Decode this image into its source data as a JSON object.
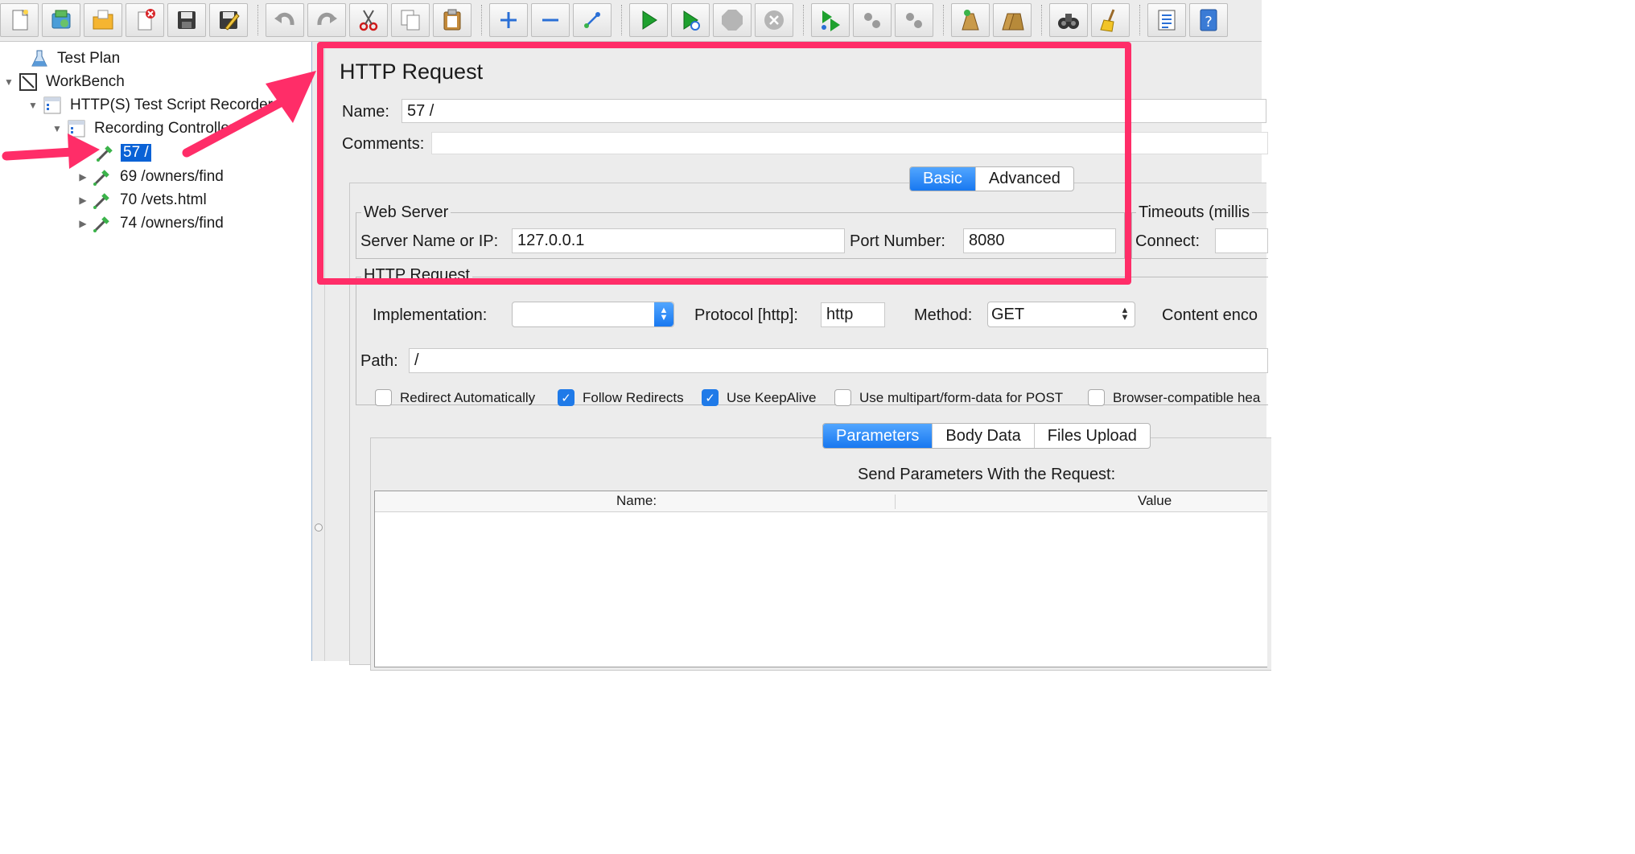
{
  "toolbar": {
    "buttons": [
      {
        "name": "new-icon"
      },
      {
        "name": "templates-icon"
      },
      {
        "name": "open-icon"
      },
      {
        "name": "close-icon"
      },
      {
        "name": "save-icon"
      },
      {
        "name": "save-as-icon"
      },
      {
        "name": "undo-icon"
      },
      {
        "name": "redo-icon"
      },
      {
        "name": "cut-icon"
      },
      {
        "name": "copy-icon"
      },
      {
        "name": "paste-icon"
      },
      {
        "name": "expand-icon"
      },
      {
        "name": "collapse-icon"
      },
      {
        "name": "toggle-icon"
      },
      {
        "name": "start-icon"
      },
      {
        "name": "start-no-pauses-icon"
      },
      {
        "name": "stop-icon"
      },
      {
        "name": "shutdown-icon"
      },
      {
        "name": "remote-start-icon"
      },
      {
        "name": "remote-stop-icon"
      },
      {
        "name": "remote-shutdown-icon"
      },
      {
        "name": "clear-icon"
      },
      {
        "name": "clear-all-icon"
      },
      {
        "name": "search-icon"
      },
      {
        "name": "reset-search-icon"
      },
      {
        "name": "function-helper-icon"
      },
      {
        "name": "help-icon"
      }
    ]
  },
  "tree": {
    "items": [
      {
        "label": "Test Plan"
      },
      {
        "label": "WorkBench"
      },
      {
        "label": "HTTP(S) Test Script Recorder"
      },
      {
        "label": "Recording Controller"
      },
      {
        "label": "57 /"
      },
      {
        "label": "69  /owners/find"
      },
      {
        "label": "70  /vets.html"
      },
      {
        "label": "74  /owners/find"
      }
    ]
  },
  "panel": {
    "title": "HTTP Request",
    "name_label": "Name:",
    "name_value": "57 /",
    "comments_label": "Comments:",
    "comments_value": "",
    "tabs": {
      "basic": "Basic",
      "advanced": "Advanced"
    },
    "web_server": {
      "title": "Web Server",
      "server_label": "Server Name or IP:",
      "server_value": "127.0.0.1",
      "port_label": "Port Number:",
      "port_value": "8080"
    },
    "timeouts": {
      "title": "Timeouts (millis",
      "connect_label": "Connect:",
      "connect_value": ""
    },
    "http_request": {
      "title": "HTTP Request",
      "implementation_label": "Implementation:",
      "implementation_value": "",
      "protocol_label": "Protocol [http]:",
      "protocol_value": "http",
      "method_label": "Method:",
      "method_value": "GET",
      "content_encoding_label": "Content enco",
      "path_label": "Path:",
      "path_value": "/"
    },
    "checkboxes": [
      {
        "label": "Redirect Automatically",
        "checked": false
      },
      {
        "label": "Follow Redirects",
        "checked": true
      },
      {
        "label": "Use KeepAlive",
        "checked": true
      },
      {
        "label": "Use multipart/form-data for POST",
        "checked": false
      },
      {
        "label": "Browser-compatible hea",
        "checked": false
      }
    ],
    "param_tabs": {
      "parameters": "Parameters",
      "body": "Body Data",
      "files": "Files Upload"
    },
    "params_caption": "Send Parameters With the Request:",
    "table_headers": {
      "name": "Name:",
      "value": "Value"
    }
  },
  "colors": {
    "accent": "#1f7ae8",
    "selection": "#0a62d6",
    "annotation": "#ff2d68"
  }
}
